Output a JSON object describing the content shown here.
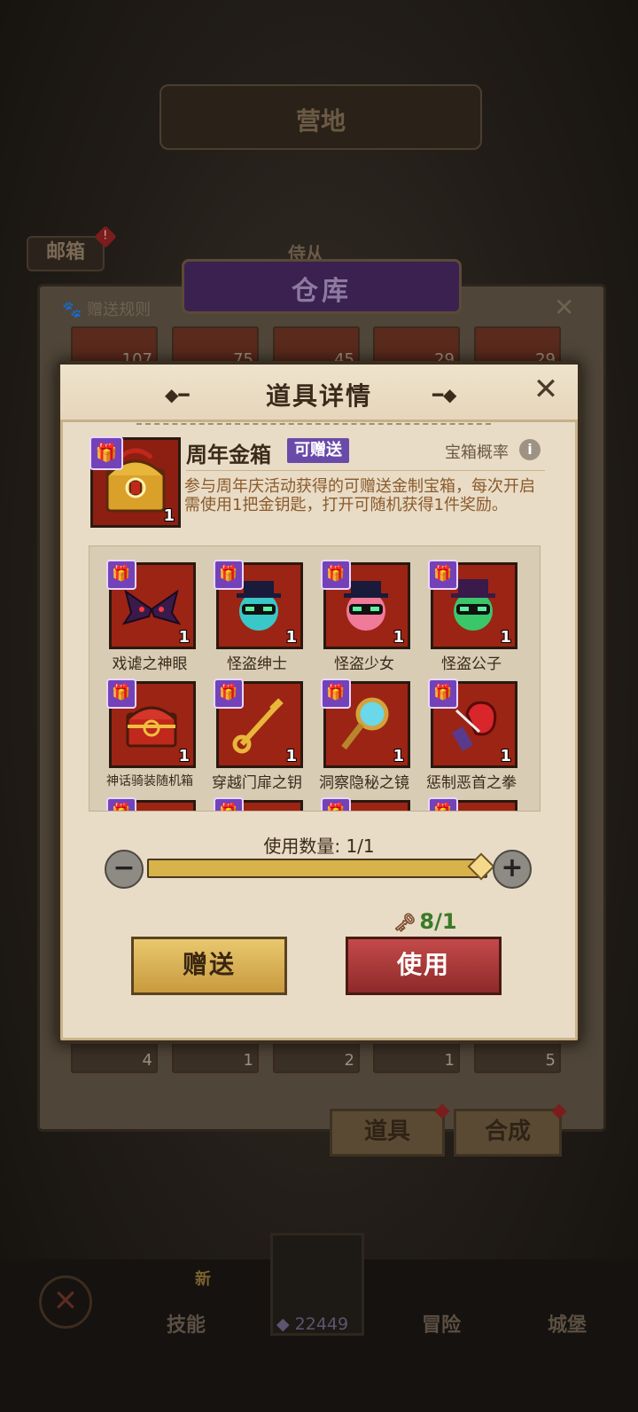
{
  "background": {
    "top_title": "营地",
    "mailbox_label": "邮箱",
    "mailbox_badge": "!",
    "attendant_tab": "侍从",
    "warehouse_title": "仓库",
    "gift_rules": "赠送规则",
    "top_row_counts": [
      "107",
      "75",
      "45",
      "29",
      "29"
    ],
    "bottom_row_counts": [
      "4",
      "1",
      "2",
      "1",
      "5"
    ],
    "tabs": [
      "道具",
      "合成"
    ],
    "nav": {
      "new_badge": "新",
      "items": [
        "技能",
        "冒险",
        "城堡"
      ],
      "gem_count": "22449"
    }
  },
  "dialog": {
    "title": "道具详情",
    "close": "✕",
    "item": {
      "name": "周年金箱",
      "giftable_tag": "可赠送",
      "probability_link": "宝箱概率",
      "count": "1",
      "description": "参与周年庆活动获得的可赠送金制宝箱，每次开启需使用1把金钥匙，打开可随机获得1件奖励。"
    },
    "rewards": [
      {
        "name": "戏谑之神眼",
        "count": "1"
      },
      {
        "name": "怪盗绅士",
        "count": "1"
      },
      {
        "name": "怪盗少女",
        "count": "1"
      },
      {
        "name": "怪盗公子",
        "count": "1"
      },
      {
        "name": "神话骑装随机箱",
        "count": "1"
      },
      {
        "name": "穿越门扉之钥",
        "count": "1"
      },
      {
        "name": "洞察隐秘之镜",
        "count": "1"
      },
      {
        "name": "惩制恶首之拳",
        "count": "1"
      }
    ],
    "quantity_label": "使用数量: 1/1",
    "quantity_fraction": 1.0,
    "key_cost": "8/1",
    "gift_button": "赠送",
    "use_button": "使用"
  },
  "colors": {
    "gift_tag": "#7342b9",
    "use_button": "#a83434",
    "gift_button": "#d9b356",
    "parchment": "#e8dcc6"
  }
}
